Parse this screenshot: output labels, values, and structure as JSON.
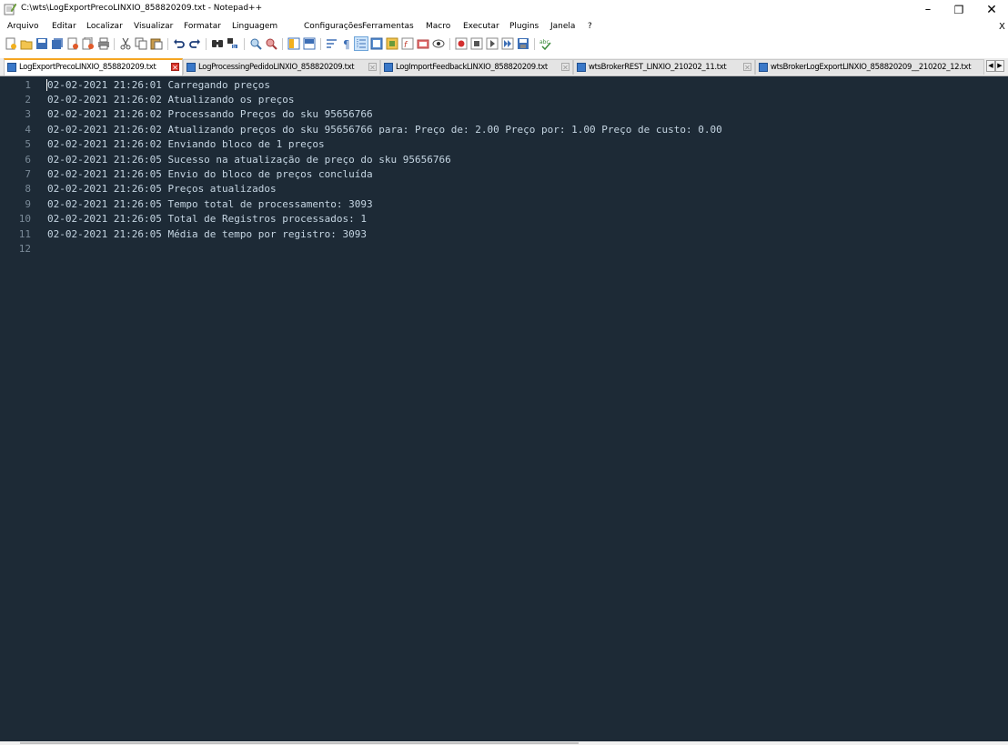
{
  "window": {
    "title": "C:\\wts\\LogExportPrecoLINXIO_858820209.txt - Notepad++",
    "min": "–",
    "max": "❐",
    "close": "✕"
  },
  "menu": [
    "Arquivo",
    "Editar",
    "Localizar",
    "Visualizar",
    "Formatar",
    "Linguagem",
    "Configurações",
    "Ferramentas",
    "Macro",
    "Executar",
    "Plugins",
    "Janela",
    "?"
  ],
  "menu_close": "X",
  "toolbar_icons": [
    "new-file-icon",
    "open-file-icon",
    "save-icon",
    "save-all-icon",
    "close-icon",
    "close-all-icon",
    "print-icon",
    "cut-icon",
    "copy-icon",
    "paste-icon",
    "undo-icon",
    "redo-icon",
    "find-icon",
    "replace-icon",
    "zoom-in-icon",
    "zoom-out-icon",
    "sync-vertical-icon",
    "sync-horizontal-icon",
    "word-wrap-icon",
    "show-all-chars-icon",
    "indent-guide-icon",
    "udl-icon",
    "doc-map-icon",
    "function-list-icon",
    "folder-workspace-icon",
    "monitoring-icon",
    "record-macro-icon",
    "stop-macro-icon",
    "play-macro-icon",
    "run-macro-multiple-icon",
    "save-macro-icon",
    "spell-check-icon"
  ],
  "tabs": [
    {
      "label": "LogExportPrecoLINXIO_858820209.txt",
      "active": true
    },
    {
      "label": "LogProcessingPedidoLINXIO_858820209.txt",
      "active": false
    },
    {
      "label": "LogImportFeedbackLINXIO_858820209.txt",
      "active": false
    },
    {
      "label": "wtsBrokerREST_LINXIO_210202_11.txt",
      "active": false
    },
    {
      "label": "wtsBrokerLogExportLINXIO_858820209__210202_12.txt",
      "active": false
    }
  ],
  "tab_nav": {
    "left": "◀",
    "right": "▶"
  },
  "editor": {
    "line_numbers": [
      "1",
      "2",
      "3",
      "4",
      "5",
      "6",
      "7",
      "8",
      "9",
      "10",
      "11",
      "12"
    ],
    "lines": [
      "02-02-2021 21:26:01 Carregando preços",
      "02-02-2021 21:26:02 Atualizando os preços",
      "02-02-2021 21:26:02 Processando Preços do sku 95656766",
      "02-02-2021 21:26:02 Atualizando preços do sku 95656766 para: Preço de: 2.00 Preço por: 1.00 Preço de custo: 0.00",
      "02-02-2021 21:26:02 Enviando bloco de 1 preços",
      "02-02-2021 21:26:05 Sucesso na atualização de preço do sku 95656766",
      "02-02-2021 21:26:05 Envio do bloco de preços concluída",
      "02-02-2021 21:26:05 Preços atualizados",
      "02-02-2021 21:26:05 Tempo total de processamento: 3093",
      "02-02-2021 21:26:05 Total de Registros processados: 1",
      "02-02-2021 21:26:05 Média de tempo por registro: 3093",
      ""
    ]
  },
  "colors": {
    "editor_bg": "#1d2a36",
    "editor_fg": "#c5d5e2",
    "gutter_fg": "#7a8a98",
    "active_tab_accent": "#f5a623"
  }
}
